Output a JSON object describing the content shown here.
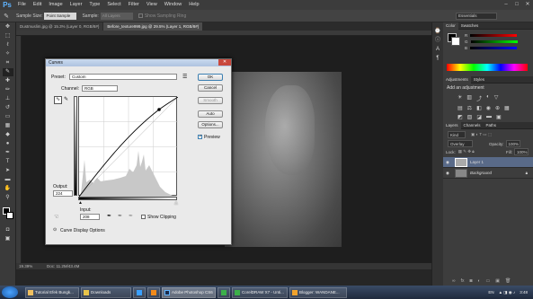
{
  "app": {
    "logo": "Ps"
  },
  "menu": [
    "File",
    "Edit",
    "Image",
    "Layer",
    "Type",
    "Select",
    "Filter",
    "View",
    "Window",
    "Help"
  ],
  "window_controls": [
    "–",
    "□",
    "✕"
  ],
  "options_bar": {
    "sample_size_label": "Sample Size:",
    "sample_size_value": "Point Sample",
    "sample_label": "Sample:",
    "sample_value": "All Layers",
    "show_ring": "Show Sampling Ring",
    "workspace": "Essentials"
  },
  "doc_tabs": [
    {
      "label": "Dustmuslim.jpg @ 15.3% (Layer 0, RGB/8#)",
      "active": false
    },
    {
      "label": "Before_texture999.jpg @ 29.5% (Layer 1, RGB/8#)",
      "active": true
    }
  ],
  "status": {
    "zoom": "19.39%",
    "doc": "Doc: 11.2M/43.4M"
  },
  "curves": {
    "title": "Curves",
    "preset_label": "Preset:",
    "preset_value": "Custom",
    "channel_label": "Channel:",
    "channel_value": "RGB",
    "output_label": "Output:",
    "output_value": "224",
    "input_label": "Input:",
    "input_value": "208",
    "show_clipping": "Show Clipping",
    "display_options": "Curve Display Options",
    "buttons": {
      "ok": "OK",
      "cancel": "Cancel",
      "smooth": "Smooth",
      "auto": "Auto",
      "options": "Options..."
    },
    "preview_label": "Preview",
    "preview_checked": true
  },
  "panels": {
    "color_tabs": [
      "Color",
      "Swatches"
    ],
    "color_rows": [
      "R",
      "G",
      "B"
    ],
    "adjust_tabs": [
      "Adjustments",
      "Styles"
    ],
    "adjust_title": "Add an adjustment",
    "layer_tabs": [
      "Layers",
      "Channels",
      "Paths"
    ],
    "kind_label": "Kind",
    "blend_mode": "Overlay",
    "opacity_label": "Opacity:",
    "opacity_value": "100%",
    "lock_label": "Lock:",
    "fill_label": "Fill:",
    "fill_value": "100%",
    "layers": [
      {
        "name": "Layer 1",
        "selected": true
      },
      {
        "name": "Background",
        "selected": false
      }
    ]
  },
  "taskbar": {
    "items": [
      {
        "label": "Tutorial Efek Bungk..."
      },
      {
        "label": "Downloads"
      },
      {
        "label": "Adobe Photoshop CS6"
      },
      {
        "label": "CorelDRAW X7 - Unti..."
      },
      {
        "label": "Blogger: WANDANE..."
      }
    ],
    "lang": "EN",
    "time": "3:48"
  }
}
